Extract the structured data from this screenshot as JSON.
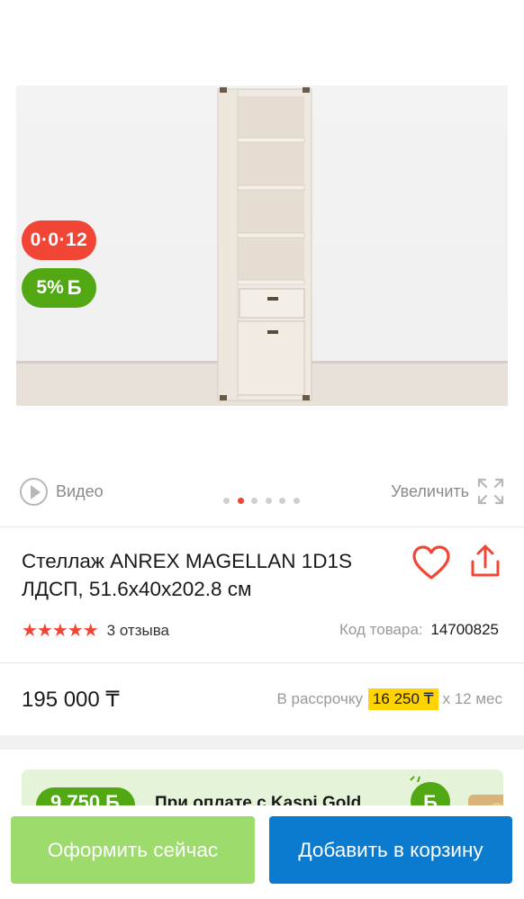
{
  "gallery": {
    "credit_badge": "0·0·12",
    "bonus_badge": "5%",
    "bonus_currency": "Б",
    "video_label": "Видео",
    "zoom_label": "Увеличить",
    "slides_total": 6,
    "active_slide": 2
  },
  "product": {
    "title": "Стеллаж ANREX MAGELLAN 1D1S ЛДСП, 51.6x40x202.8 см",
    "rating_stars": "★★★★★",
    "reviews": "3 отзыва",
    "code_label": "Код товара:",
    "code_value": "14700825"
  },
  "pricing": {
    "price": "195 000 ₸",
    "installment_label": "В рассрочку",
    "installment_amount": "16 250 ₸",
    "installment_term": "х 12 мес"
  },
  "promo": {
    "amount": "9 750 Б",
    "text": "При оплате с Kaspi Gold"
  },
  "actions": {
    "checkout_label": "Оформить сейчас",
    "cart_label": "Добавить в корзину"
  },
  "colors": {
    "accent_red": "#f14635",
    "bonus_green": "#52a813",
    "checkout_green": "#9cdb6c",
    "cart_blue": "#0b7bcf",
    "installment_yellow": "#ffd400"
  }
}
